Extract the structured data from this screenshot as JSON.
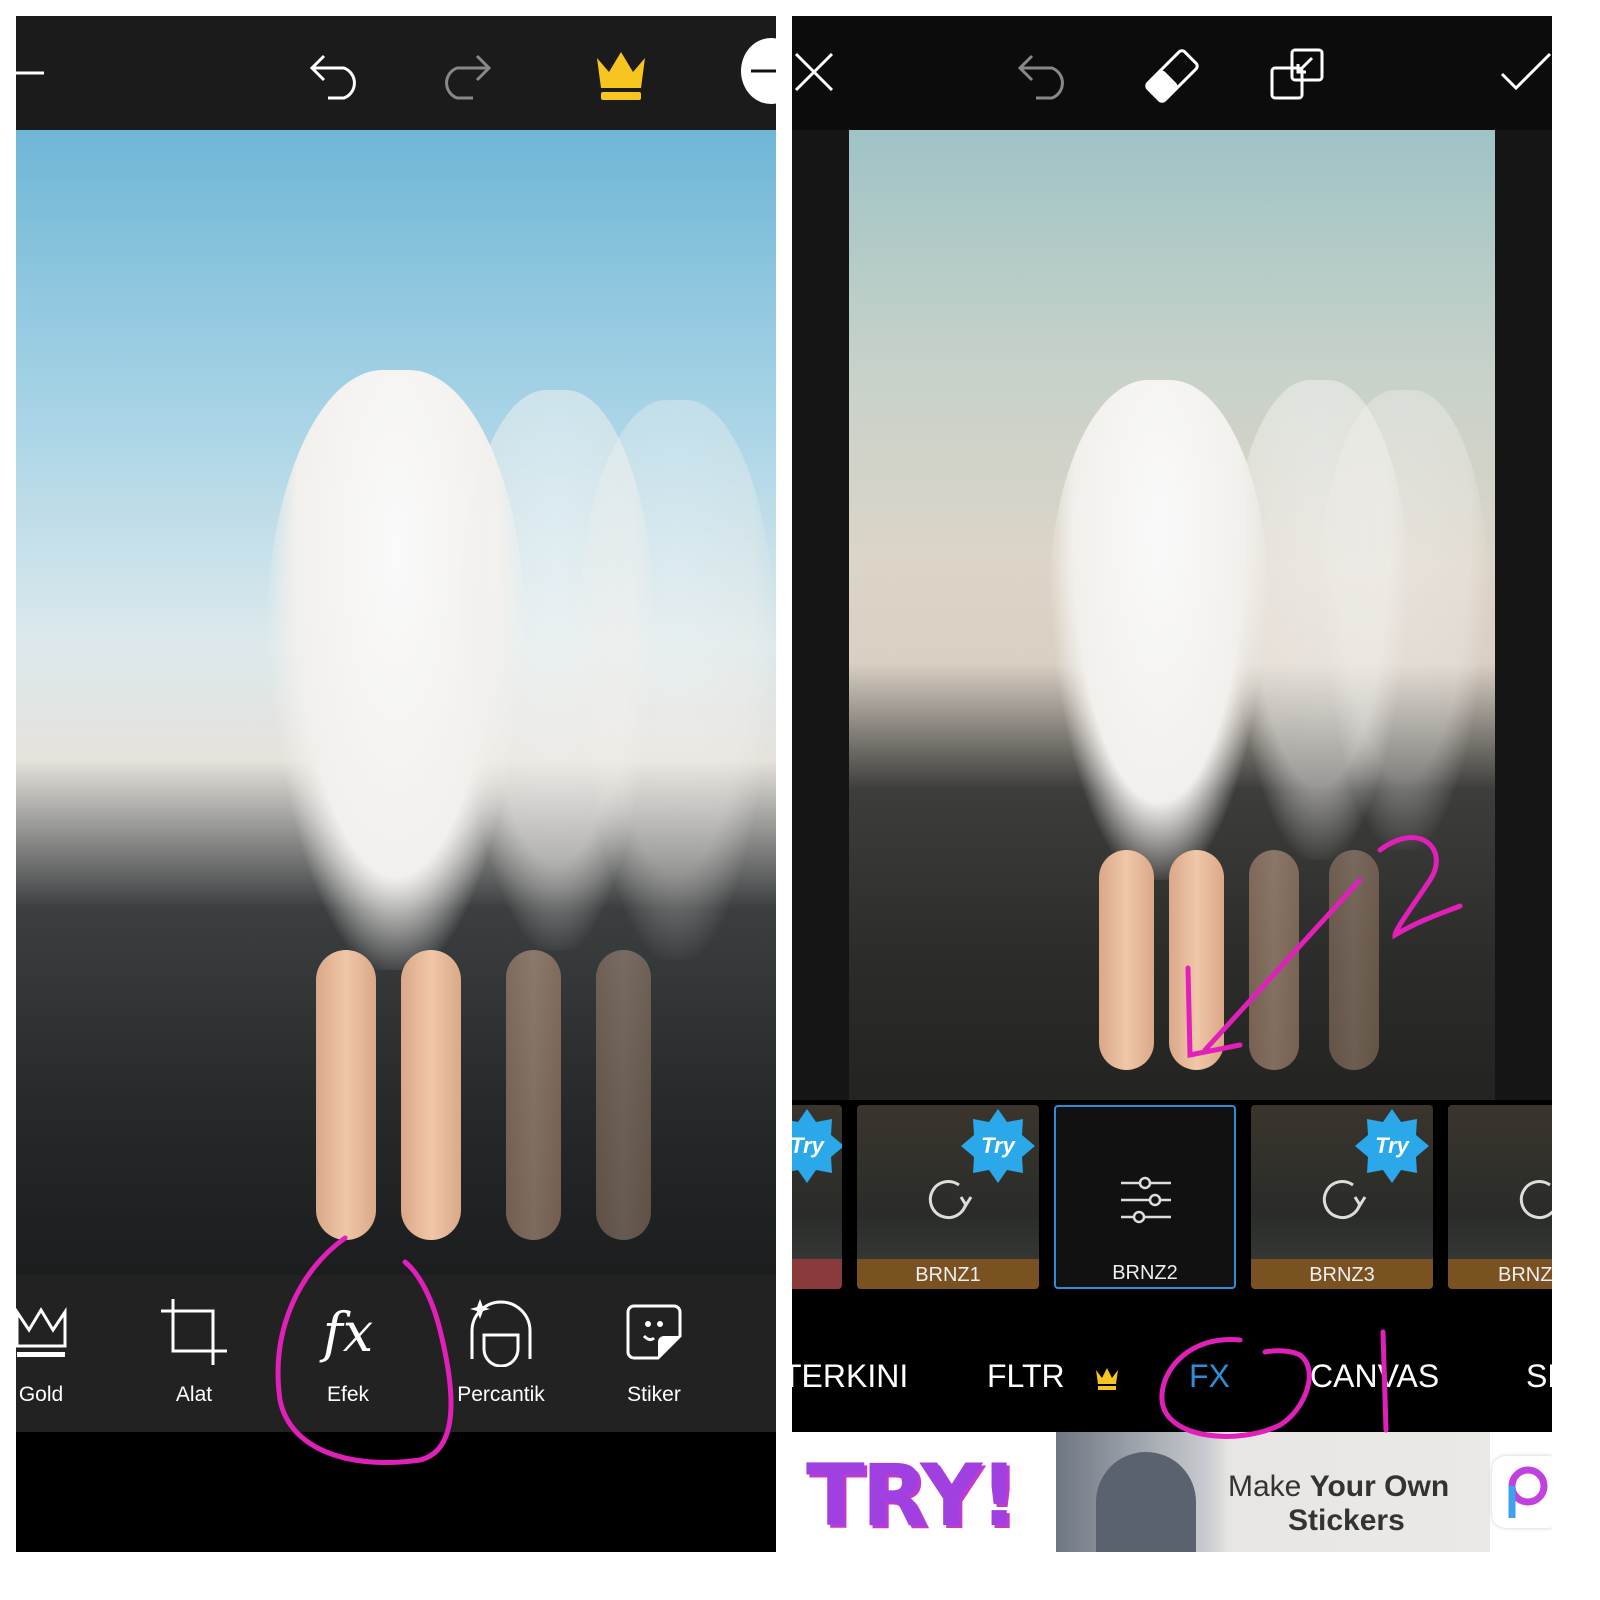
{
  "left_editor": {
    "topbar": {
      "icons": [
        "back-arrow-icon",
        "undo-icon",
        "redo-icon",
        "crown-icon",
        "minus-icon"
      ],
      "crown_color": "#f7c520"
    },
    "toolbar": [
      {
        "label": "Gold",
        "icon": "crown-outline-icon"
      },
      {
        "label": "Alat",
        "icon": "crop-icon"
      },
      {
        "label": "Efek",
        "icon": "fx-icon"
      },
      {
        "label": "Percantik",
        "icon": "beautify-face-icon"
      },
      {
        "label": "Stiker",
        "icon": "sticker-icon"
      }
    ],
    "fx_glyph": "fx"
  },
  "right_editor": {
    "topbar": {
      "icons": [
        "close-icon",
        "undo-icon",
        "eraser-icon",
        "compare-icon",
        "check-icon"
      ]
    },
    "effects": [
      {
        "label": "",
        "try": "Try"
      },
      {
        "label": "BRNZ1",
        "try": "Try"
      },
      {
        "label": "BRNZ2",
        "selected": true
      },
      {
        "label": "BRNZ3",
        "try": "Try"
      },
      {
        "label": "BRNZ",
        "try": ""
      }
    ],
    "tabs": [
      {
        "label": "TERKINI"
      },
      {
        "label": "FLTR",
        "premium": true
      },
      {
        "label": "FX",
        "active": true
      },
      {
        "label": "CANVAS"
      },
      {
        "label": "SE"
      }
    ],
    "accent_color": "#2b8fd8",
    "ad": {
      "headline": "TRY!",
      "text_light": "Make",
      "text_bold": "Your Own",
      "text_bold2": "Stickers"
    }
  },
  "annotations": {
    "color": "#e020b8",
    "marks": [
      "1",
      "2"
    ]
  }
}
